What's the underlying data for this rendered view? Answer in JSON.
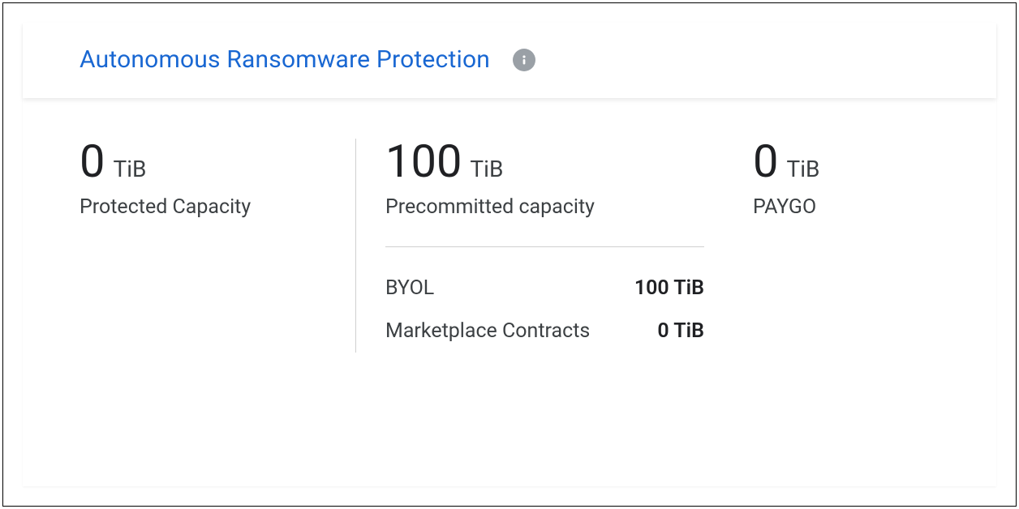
{
  "header": {
    "title": "Autonomous Ransomware Protection",
    "info_icon": "info-icon"
  },
  "stats": {
    "protected": {
      "value": "0",
      "unit": "TiB",
      "label": "Protected Capacity"
    },
    "precommitted": {
      "value": "100",
      "unit": "TiB",
      "label": "Precommitted capacity",
      "breakdown": [
        {
          "label": "BYOL",
          "value": "100 TiB"
        },
        {
          "label": "Marketplace Contracts",
          "value": "0 TiB"
        }
      ]
    },
    "paygo": {
      "value": "0",
      "unit": "TiB",
      "label": "PAYGO"
    }
  }
}
